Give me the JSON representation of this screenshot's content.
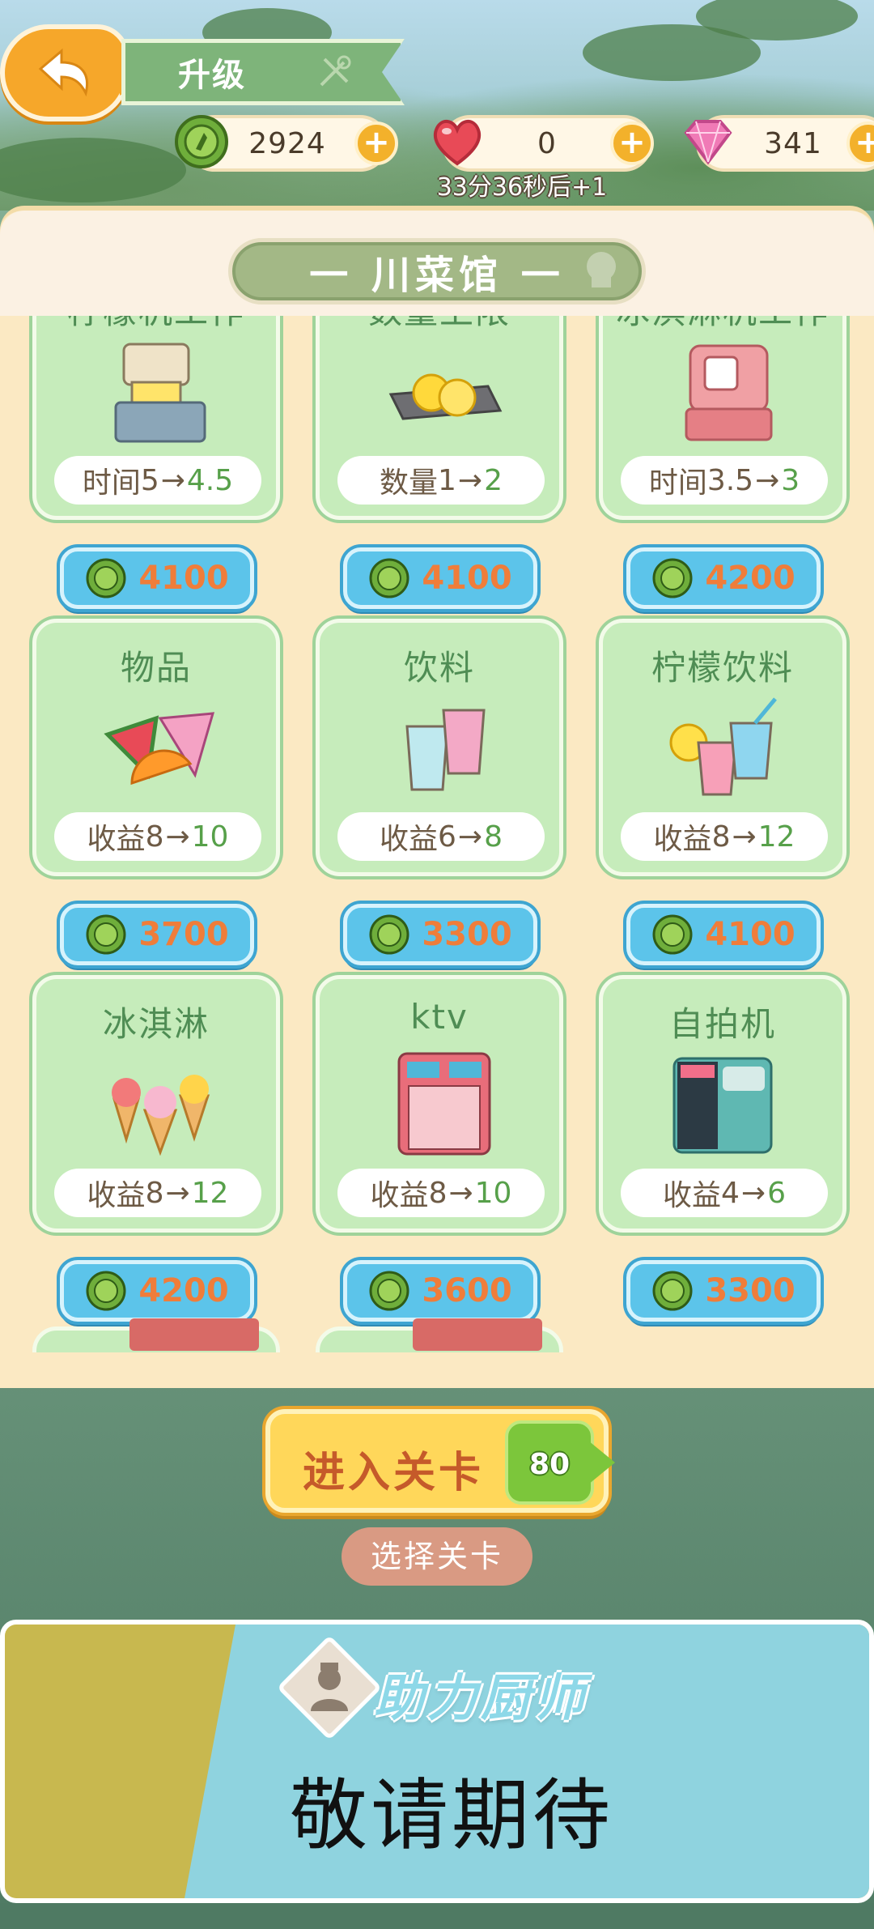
{
  "header": {
    "title": "升级",
    "coins": "2924",
    "hearts": "0",
    "gems": "341",
    "heart_timer": "33分36秒后+1"
  },
  "shop": {
    "title": "一 川菜馆 一"
  },
  "upgrades": [
    {
      "name": "柠檬机工作",
      "stat_label": "时间",
      "from": "5",
      "to": "4.5",
      "cost": "4100"
    },
    {
      "name": "数量上限",
      "stat_label": "数量",
      "from": "1",
      "to": "2",
      "cost": "4100"
    },
    {
      "name": "冰淇淋机工作",
      "stat_label": "时间",
      "from": "3.5",
      "to": "3",
      "cost": "4200"
    },
    {
      "name": "物品",
      "stat_label": "收益",
      "from": "8",
      "to": "10",
      "cost": "3700"
    },
    {
      "name": "饮料",
      "stat_label": "收益",
      "from": "6",
      "to": "8",
      "cost": "3300"
    },
    {
      "name": "柠檬饮料",
      "stat_label": "收益",
      "from": "8",
      "to": "12",
      "cost": "4100"
    },
    {
      "name": "冰淇淋",
      "stat_label": "收益",
      "from": "8",
      "to": "12",
      "cost": "4200"
    },
    {
      "name": "ktv",
      "stat_label": "收益",
      "from": "8",
      "to": "10",
      "cost": "3600"
    },
    {
      "name": "自拍机",
      "stat_label": "收益",
      "from": "4",
      "to": "6",
      "cost": "3300"
    }
  ],
  "arrow": "→",
  "actions": {
    "enter_level": "进入关卡",
    "level_number": "80",
    "select_level": "选择关卡"
  },
  "helper": {
    "title": "助力厨师",
    "coming_soon": "敬请期待"
  },
  "colors": {
    "card_green": "#c6ecbb",
    "stat_new": "#57a04a",
    "cost_blue": "#5cc4ea",
    "cost_text": "#ef7d3a",
    "enter_yellow": "#ffd75a",
    "helper_blue": "#8fd3df",
    "helper_olive": "#c8b84f"
  }
}
